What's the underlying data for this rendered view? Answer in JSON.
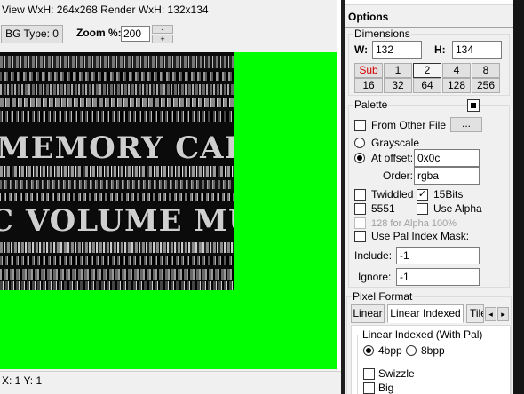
{
  "viewer": {
    "title": "View WxH: 264x268 Render WxH: 132x134",
    "bg_type_label": "BG Type: 0",
    "zoom_label": "Zoom %:",
    "zoom_value": "200",
    "spin_up": "-",
    "spin_down": "+",
    "texture_words": [
      "MEMORY CARD",
      "C VOLUME MUSIC"
    ],
    "status": "X: 1 Y: 1",
    "canvas_bg": "#00ff00"
  },
  "options": {
    "title": "Options",
    "dimensions": {
      "legend": "Dimensions",
      "w_label": "W:",
      "w_value": "132",
      "h_label": "H:",
      "h_value": "134",
      "buttons_row1": [
        "Sub",
        "1",
        "2",
        "4",
        "8"
      ],
      "buttons_row2": [
        "16",
        "32",
        "64",
        "128",
        "256"
      ]
    },
    "palette": {
      "legend": "Palette",
      "save_icon": "floppy-disk-icon",
      "from_other_file": "From Other File",
      "browse_label": "...",
      "grayscale": "Grayscale",
      "at_offset": "At offset:",
      "offset_value": "0x0c",
      "order_label": "Order:",
      "order_value": "rgba",
      "twiddled": "Twiddled",
      "bits15": "15Bits",
      "mode5551": "5551",
      "use_alpha": "Use Alpha",
      "alpha128": "128 for Alpha 100%",
      "use_pal_mask": "Use Pal Index Mask:",
      "include_label": "Include:",
      "include_value": "-1",
      "ignore_label": "Ignore:",
      "ignore_value": "-1"
    },
    "pixel_format": {
      "legend": "Pixel Format",
      "tabs": [
        "Linear",
        "Linear Indexed",
        "Tile"
      ],
      "tab_scroll_left": "◂",
      "tab_scroll_right": "▸",
      "sub_legend": "Linear Indexed (With Pal)",
      "bpp4": "4bpp",
      "bpp8": "8bpp",
      "swizzle": "Swizzle",
      "big": "Big"
    }
  }
}
